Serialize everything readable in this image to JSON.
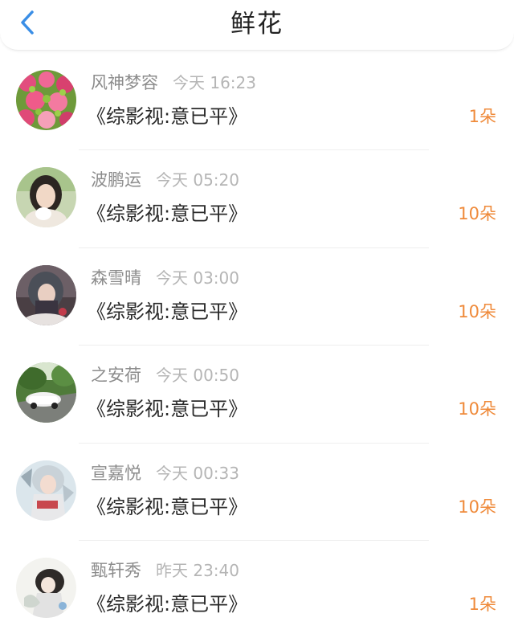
{
  "header": {
    "title": "鲜花",
    "back_icon": "chevron-left-icon",
    "accent": "#3a8ee6"
  },
  "colors": {
    "count": "#ef8a3a",
    "name": "#8c8c8c",
    "time": "#b5b5b5"
  },
  "items": [
    {
      "name": "风神梦容",
      "time": "今天 16:23",
      "book": "《综影视:意已平》",
      "count": "1朵"
    },
    {
      "name": "波鹏运",
      "time": "今天 05:20",
      "book": "《综影视:意已平》",
      "count": "10朵"
    },
    {
      "name": "森雪晴",
      "time": "今天 03:00",
      "book": "《综影视:意已平》",
      "count": "10朵"
    },
    {
      "name": "之安荷",
      "time": "今天 00:50",
      "book": "《综影视:意已平》",
      "count": "10朵"
    },
    {
      "name": "宣嘉悦",
      "time": "今天 00:33",
      "book": "《综影视:意已平》",
      "count": "10朵"
    },
    {
      "name": "甄轩秀",
      "time": "昨天 23:40",
      "book": "《综影视:意已平》",
      "count": "1朵"
    }
  ]
}
